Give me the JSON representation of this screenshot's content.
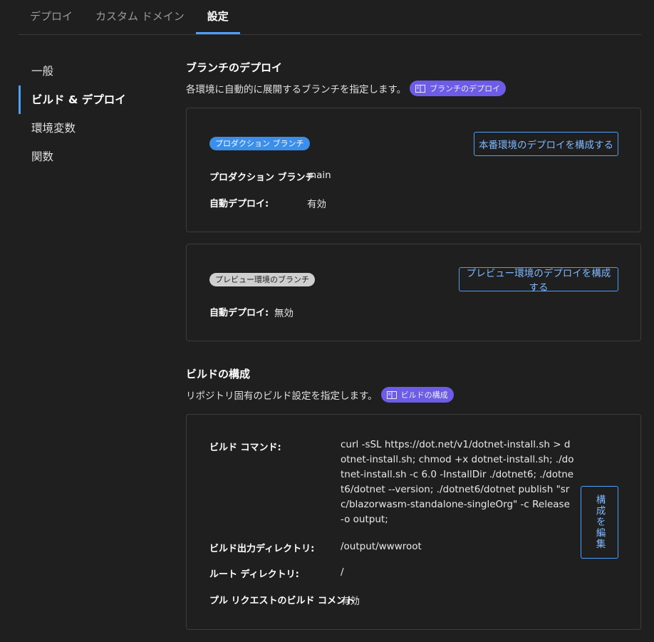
{
  "tabs": [
    {
      "label": "デプロイ"
    },
    {
      "label": "カスタム ドメイン"
    },
    {
      "label": "設定"
    }
  ],
  "sidebar": {
    "items": [
      {
        "label": "一般"
      },
      {
        "label": "ビルド & デプロイ"
      },
      {
        "label": "環境変数"
      },
      {
        "label": "関数"
      }
    ],
    "active": "ビルド & デプロイ"
  },
  "branch_deploy": {
    "title": "ブランチのデプロイ",
    "description": "各環境に自動的に展開するブランチを指定します。",
    "doc_badge": "ブランチのデプロイ",
    "production": {
      "pill": "プロダクション ブランチ",
      "button": "本番環境のデプロイを構成する",
      "branch_label": "プロダクション ブランチ",
      "branch_value": "main",
      "auto_label": "自動デプロイ:",
      "auto_value": "有効"
    },
    "preview": {
      "pill": "プレビュー環境のブランチ",
      "button": "プレビュー環境のデプロイを構成する",
      "auto_label": "自動デプロイ:",
      "auto_value": "無効"
    }
  },
  "build_config": {
    "title": "ビルドの構成",
    "description": "リポジトリ固有のビルド設定を指定します。",
    "doc_badge": "ビルドの構成",
    "command_label": "ビルド コマンド:",
    "command_value": "curl -sSL https://dot.net/v1/dotnet-install.sh > dotnet-install.sh; chmod +x dotnet-install.sh; ./dotnet-install.sh -c 6.0 -InstallDir ./dotnet6; ./dotnet6/dotnet --version; ./dotnet6/dotnet publish \"src/blazorwasm-standalone-singleOrg\" -c Release -o output;",
    "output_label": "ビルド出力ディレクトリ:",
    "output_value": "/output/wwwroot",
    "root_label": "ルート ディレクトリ:",
    "root_value": "/",
    "pr_label": "プル リクエストのビルド コメント",
    "pr_value": "有効",
    "edit_button": "構成を編集"
  },
  "colors": {
    "accent": "#4a9fff",
    "badge_purple": "#6c5ce7",
    "pill_blue": "#3b8eea",
    "pill_gray": "#cfcfcf",
    "background": "#1f1f1f"
  }
}
